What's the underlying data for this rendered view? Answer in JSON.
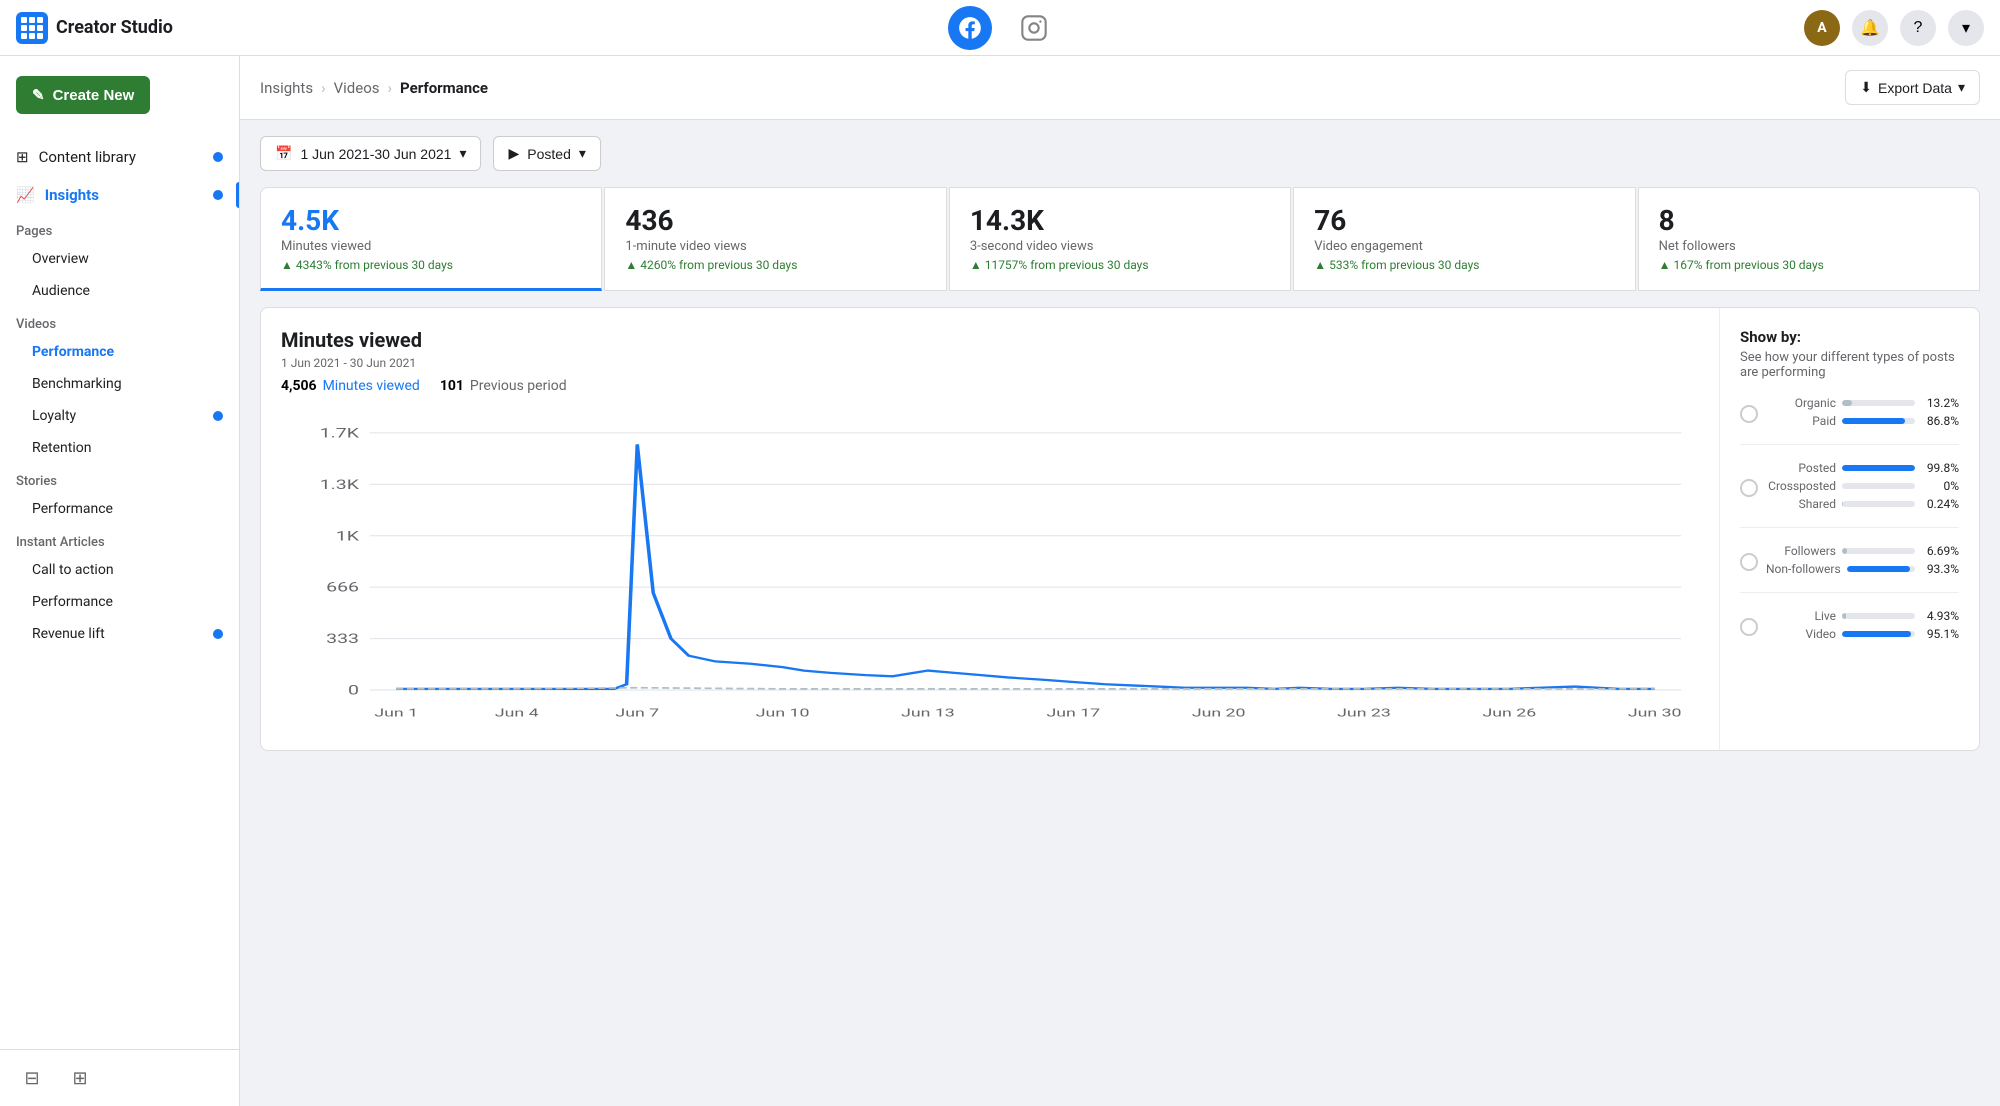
{
  "app": {
    "title": "Creator Studio",
    "logo_grid": [
      1,
      2,
      3,
      4,
      5,
      6,
      7,
      8,
      9
    ]
  },
  "topnav": {
    "facebook_active": true,
    "instagram_label": "Instagram",
    "avatar_initials": "A",
    "bell_label": "Notifications",
    "help_label": "Help",
    "chevron_label": "More"
  },
  "sidebar": {
    "create_btn": "Create New",
    "items": [
      {
        "id": "content-library",
        "label": "Content library",
        "dot": true,
        "active": false
      },
      {
        "id": "insights",
        "label": "Insights",
        "active": true,
        "dot": true
      }
    ],
    "insights_sections": [
      {
        "section": "Pages",
        "items": [
          {
            "id": "overview",
            "label": "Overview",
            "active": false
          },
          {
            "id": "audience",
            "label": "Audience",
            "active": false
          }
        ]
      },
      {
        "section": "Videos",
        "items": [
          {
            "id": "performance",
            "label": "Performance",
            "active": true
          },
          {
            "id": "benchmarking",
            "label": "Benchmarking",
            "active": false
          },
          {
            "id": "loyalty",
            "label": "Loyalty",
            "active": false,
            "dot": true
          },
          {
            "id": "retention",
            "label": "Retention",
            "active": false
          }
        ]
      },
      {
        "section": "Stories",
        "items": [
          {
            "id": "stories-performance",
            "label": "Performance",
            "active": false
          }
        ]
      },
      {
        "section": "Instant Articles",
        "items": [
          {
            "id": "call-to-action",
            "label": "Call to action",
            "active": false
          },
          {
            "id": "ia-performance",
            "label": "Performance",
            "active": false
          },
          {
            "id": "revenue-lift",
            "label": "Revenue lift",
            "active": false,
            "dot": true
          }
        ]
      }
    ]
  },
  "breadcrumb": {
    "items": [
      "Insights",
      "Videos",
      "Performance"
    ],
    "current": "Performance"
  },
  "export_btn": "Export Data",
  "filters": {
    "date_range": "1 Jun 2021-30 Jun 2021",
    "posted": "Posted"
  },
  "metrics": [
    {
      "value": "4.5K",
      "label": "Minutes viewed",
      "change": "4343% from previous 30 days",
      "blue": true
    },
    {
      "value": "436",
      "label": "1-minute video views",
      "change": "4260% from previous 30 days",
      "blue": false
    },
    {
      "value": "14.3K",
      "label": "3-second video views",
      "change": "11757% from previous 30 days",
      "blue": false
    },
    {
      "value": "76",
      "label": "Video engagement",
      "change": "533% from previous 30 days",
      "blue": false
    },
    {
      "value": "8",
      "label": "Net followers",
      "change": "167% from previous 30 days",
      "blue": false
    }
  ],
  "chart": {
    "title": "Minutes viewed",
    "date_range": "1 Jun 2021 - 30 Jun 2021",
    "current_value": "4,506",
    "current_label": "Minutes viewed",
    "prev_value": "101",
    "prev_label": "Previous period",
    "y_labels": [
      "1.7K",
      "1.3K",
      "1K",
      "666",
      "333",
      "0"
    ],
    "x_labels": [
      "Jun 1",
      "Jun 4",
      "Jun 7",
      "Jun 10",
      "Jun 13",
      "Jun 17",
      "Jun 20",
      "Jun 23",
      "Jun 26",
      "Jun 30"
    ]
  },
  "show_by": {
    "title": "Show by:",
    "description": "See how your different types of posts are performing",
    "groups": [
      {
        "id": "group1",
        "bars": [
          {
            "label": "Organic",
            "pct": 13.2,
            "pct_label": "13.2%",
            "type": "light"
          },
          {
            "label": "Paid",
            "pct": 86.8,
            "pct_label": "86.8%",
            "type": "blue"
          }
        ]
      },
      {
        "id": "group2",
        "bars": [
          {
            "label": "Posted",
            "pct": 99.8,
            "pct_label": "99.8%",
            "type": "blue"
          },
          {
            "label": "Crossposted",
            "pct": 0,
            "pct_label": "0%",
            "type": "light"
          },
          {
            "label": "Shared",
            "pct": 0.24,
            "pct_label": "0.24%",
            "type": "light"
          }
        ]
      },
      {
        "id": "group3",
        "bars": [
          {
            "label": "Followers",
            "pct": 6.69,
            "pct_label": "6.69%",
            "type": "light"
          },
          {
            "label": "Non-followers",
            "pct": 93.3,
            "pct_label": "93.3%",
            "type": "blue"
          }
        ]
      },
      {
        "id": "group4",
        "bars": [
          {
            "label": "Live",
            "pct": 4.93,
            "pct_label": "4.93%",
            "type": "light"
          },
          {
            "label": "Video",
            "pct": 95.1,
            "pct_label": "95.1%",
            "type": "blue"
          }
        ]
      }
    ]
  }
}
